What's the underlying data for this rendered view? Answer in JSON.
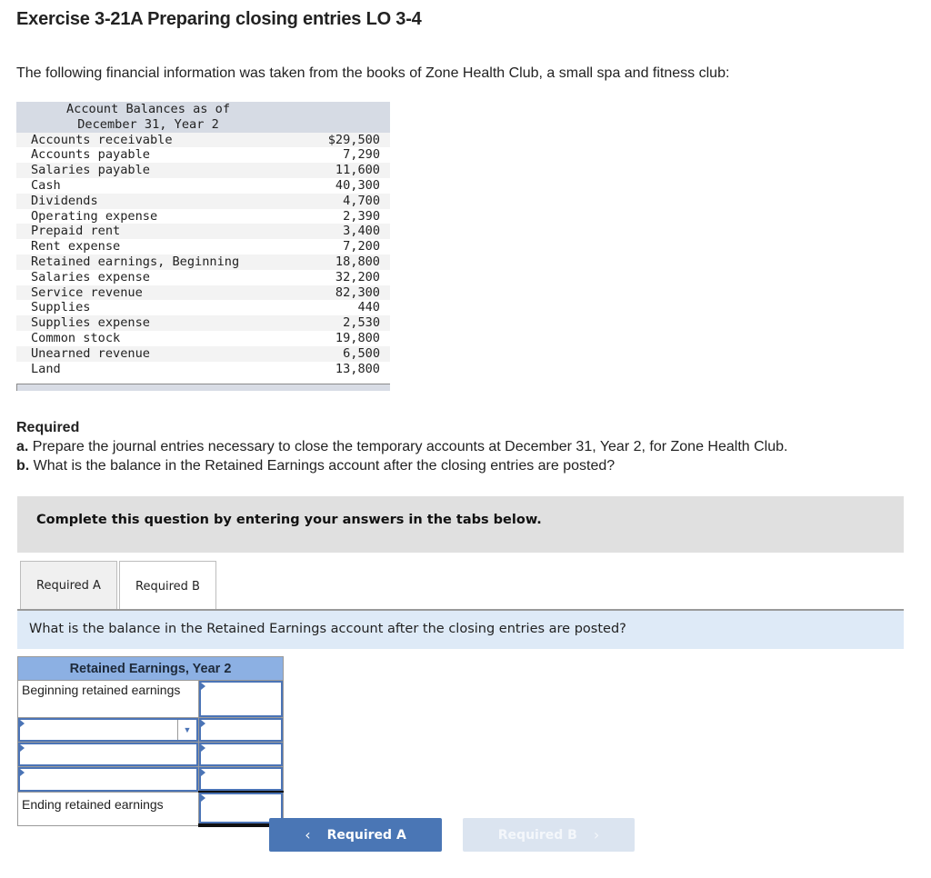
{
  "title": "Exercise 3-21A Preparing closing entries LO 3-4",
  "intro": "The following financial information was taken from the books of Zone Health Club, a small spa and fitness club:",
  "balances": {
    "header_line1": "Account Balances as of",
    "header_line2": "December 31, Year 2",
    "rows": [
      {
        "account": "Accounts receivable",
        "amount": "$29,500"
      },
      {
        "account": "Accounts payable",
        "amount": "7,290"
      },
      {
        "account": "Salaries payable",
        "amount": "11,600"
      },
      {
        "account": "Cash",
        "amount": "40,300"
      },
      {
        "account": "Dividends",
        "amount": "4,700"
      },
      {
        "account": "Operating expense",
        "amount": "2,390"
      },
      {
        "account": "Prepaid rent",
        "amount": "3,400"
      },
      {
        "account": "Rent expense",
        "amount": "7,200"
      },
      {
        "account": "Retained earnings, Beginning",
        "amount": "18,800"
      },
      {
        "account": "Salaries expense",
        "amount": "32,200"
      },
      {
        "account": "Service revenue",
        "amount": "82,300"
      },
      {
        "account": "Supplies",
        "amount": "440"
      },
      {
        "account": "Supplies expense",
        "amount": "2,530"
      },
      {
        "account": "Common stock",
        "amount": "19,800"
      },
      {
        "account": "Unearned revenue",
        "amount": "6,500"
      },
      {
        "account": "Land",
        "amount": "13,800"
      }
    ]
  },
  "required": {
    "heading": "Required",
    "a_label": "a.",
    "a_text": " Prepare the journal entries necessary to close the temporary accounts at December 31, Year 2, for Zone Health Club.",
    "b_label": "b.",
    "b_text": " What is the balance in the Retained Earnings account after the closing entries are posted?"
  },
  "banner": "Complete this question by entering your answers in the tabs below.",
  "tabs": [
    {
      "label": "Required A",
      "active": false
    },
    {
      "label": "Required B",
      "active": true
    }
  ],
  "question": "What is the balance in the Retained Earnings account after the closing entries are posted?",
  "re_table": {
    "title": "Retained Earnings, Year 2",
    "beginning_label": "Beginning retained earnings",
    "ending_label": "Ending retained earnings",
    "beginning_value": "",
    "row1_select": "",
    "row1_value": "",
    "row2_label": "",
    "row2_value": "",
    "row3_label": "",
    "row3_value": "",
    "ending_value": ""
  },
  "nav": {
    "prev_label": "Required A",
    "next_label": "Required B",
    "prev_chevron": "‹",
    "next_chevron": "›"
  }
}
